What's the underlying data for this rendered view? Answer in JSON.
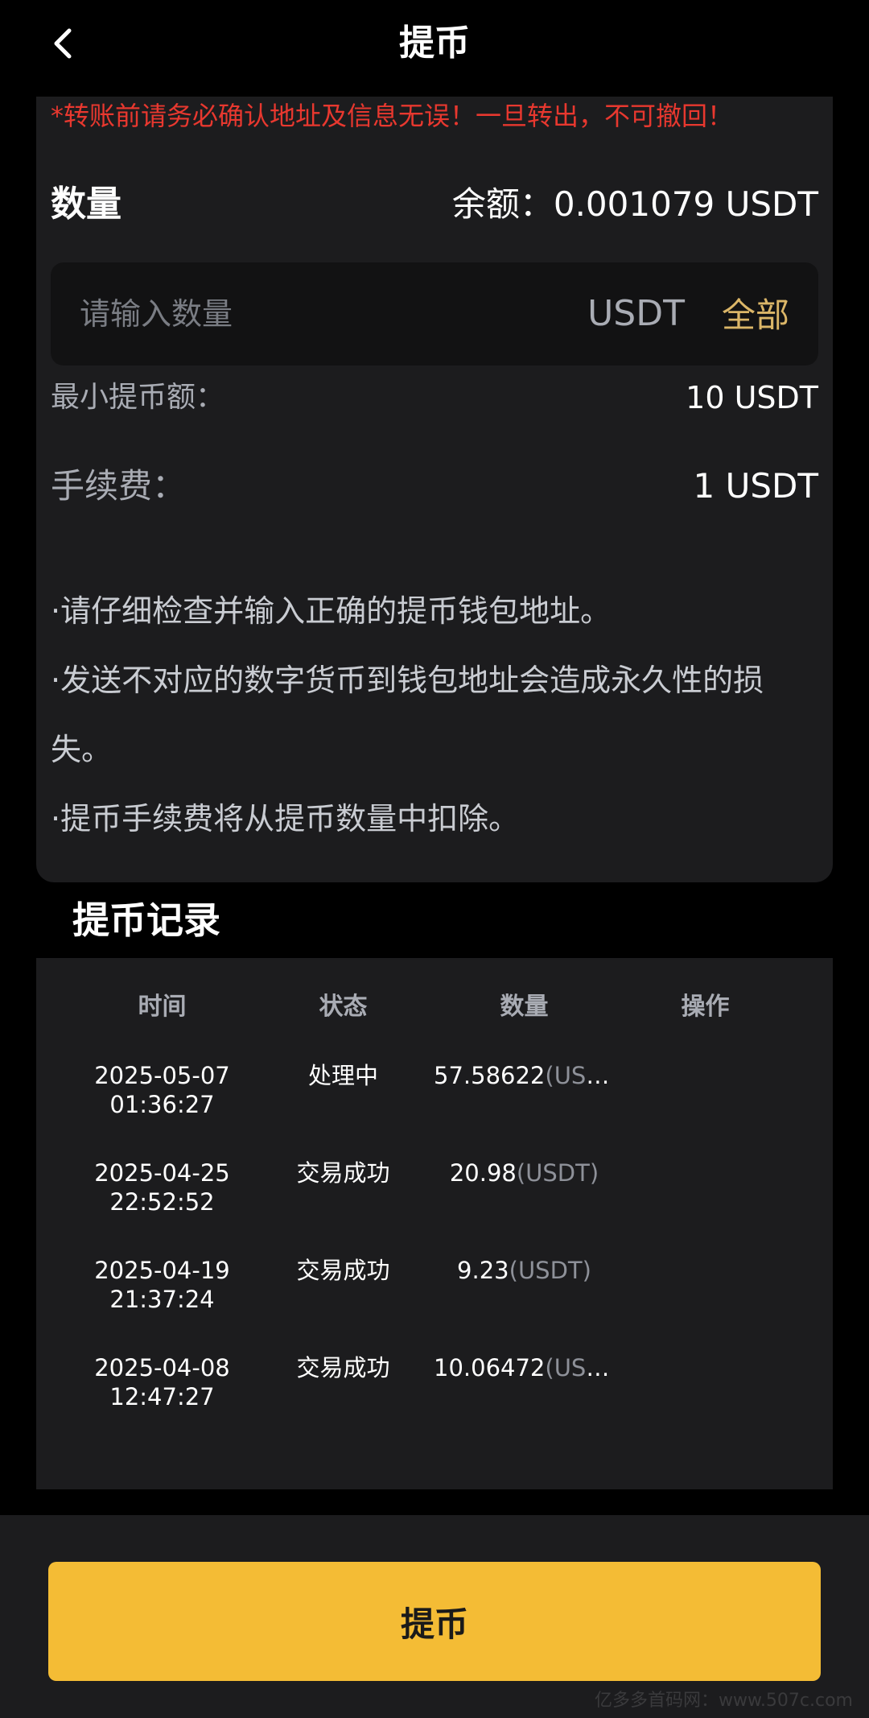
{
  "header": {
    "title": "提币",
    "back_icon": "chevron-left-icon"
  },
  "form": {
    "warning": "*转账前请务必确认地址及信息无误！一旦转出，不可撤回！",
    "quantity_label": "数量",
    "balance": "余额：0.001079 USDT",
    "amount_placeholder": "请输入数量",
    "unit": "USDT",
    "all_label": "全部",
    "min_label": "最小提币额：",
    "min_value": "10 USDT",
    "fee_label": "手续费：",
    "fee_value": "1 USDT",
    "notes": [
      "·请仔细检查并输入正确的提币钱包地址。",
      "·发送不对应的数字货币到钱包地址会造成永久性的损失。",
      "·提币手续费将从提币数量中扣除。"
    ]
  },
  "records": {
    "title": "提币记录",
    "columns": [
      "时间",
      "状态",
      "数量",
      "操作"
    ],
    "rows": [
      {
        "date": "2025-05-07",
        "time": "01:36:27",
        "status": "处理中",
        "amount": "57.58622",
        "unit": "(USDT)"
      },
      {
        "date": "2025-04-25",
        "time": "22:52:52",
        "status": "交易成功",
        "amount": "20.98",
        "unit": "(USDT)"
      },
      {
        "date": "2025-04-19",
        "time": "21:37:24",
        "status": "交易成功",
        "amount": "9.23",
        "unit": "(USDT)"
      },
      {
        "date": "2025-04-08",
        "time": "12:47:27",
        "status": "交易成功",
        "amount": "10.06472",
        "unit": "(USDT)"
      }
    ]
  },
  "footer": {
    "submit_label": "提币"
  },
  "watermark": "亿多多首码网：www.507c.com",
  "colors": {
    "background": "#000000",
    "card": "#1c1c1e",
    "warning": "#e8382f",
    "accent_gold": "#dbb668",
    "button": "#f4bc35"
  }
}
